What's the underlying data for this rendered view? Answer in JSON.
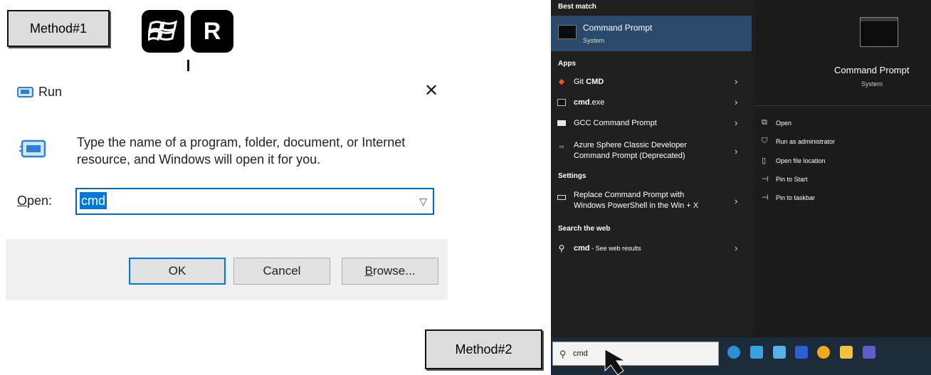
{
  "method1": {
    "label": "Method#1",
    "key_r": "R"
  },
  "method2": {
    "label": "Method#2"
  },
  "run_dialog": {
    "title": "Run",
    "description": "Type the name of a program, folder, document, or Internet resource, and Windows will open it for you.",
    "open_label_underlined": "O",
    "open_label_rest": "pen:",
    "input_value": "cmd",
    "ok_label": "OK",
    "cancel_label": "Cancel",
    "browse_underlined": "B",
    "browse_rest": "rowse..."
  },
  "start_menu": {
    "best_match_heading": "Best match",
    "best_match_title": "Command Prompt",
    "best_match_sub": "System",
    "apps_heading": "Apps",
    "apps": [
      {
        "pre": "Git ",
        "bold": "CMD",
        "post": ""
      },
      {
        "pre": "",
        "bold": "cmd",
        "post": ".exe"
      },
      {
        "pre": "GCC Command Prompt",
        "bold": "",
        "post": ""
      },
      {
        "line1": "Azure Sphere Classic Developer",
        "line2": "Command Prompt (Deprecated)"
      }
    ],
    "settings_heading": "Settings",
    "settings_item": {
      "line1": "Replace Command Prompt with",
      "line2": "Windows PowerShell in the Win + X"
    },
    "web_heading": "Search the web",
    "web_item_bold": "cmd",
    "web_item_rest": " - See web results",
    "preview_title": "Command Prompt",
    "preview_sub": "System",
    "actions": [
      "Open",
      "Run as administrator",
      "Open file location",
      "Pin to Start",
      "Pin to taskbar"
    ],
    "taskbar_search_value": "cmd"
  },
  "colors": {
    "accent": "#0078d7",
    "best_match_bg": "#2a4a6b"
  }
}
